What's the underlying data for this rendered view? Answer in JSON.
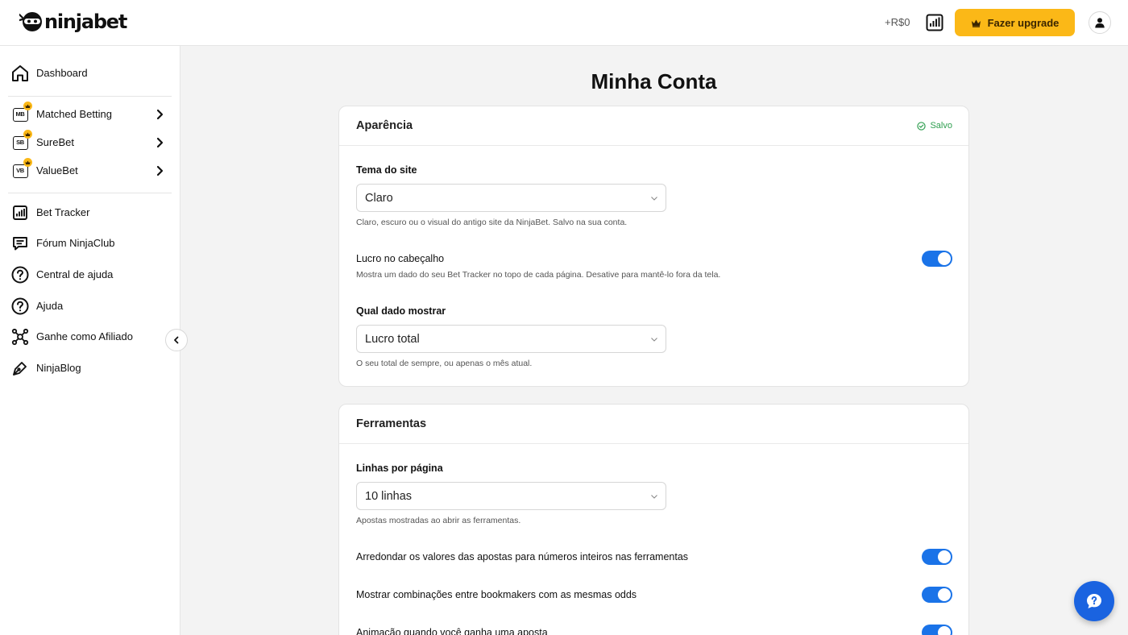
{
  "header": {
    "logo_text": "ninjabet",
    "profit": "+R$0",
    "upgrade_label": "Fazer upgrade"
  },
  "sidebar": {
    "items": [
      {
        "label": "Dashboard",
        "icon": "home-icon"
      },
      {
        "label": "Matched Betting",
        "icon": "mb-badge-icon",
        "badge": "MB"
      },
      {
        "label": "SureBet",
        "icon": "sb-badge-icon",
        "badge": "SB"
      },
      {
        "label": "ValueBet",
        "icon": "vb-badge-icon",
        "badge": "VB"
      },
      {
        "label": "Bet Tracker",
        "icon": "bar-chart-icon"
      },
      {
        "label": "Fórum NinjaClub",
        "icon": "chat-icon"
      },
      {
        "label": "Central de ajuda",
        "icon": "question-circle-icon"
      },
      {
        "label": "Ajuda",
        "icon": "question-circle-icon"
      },
      {
        "label": "Ganhe como Afiliado",
        "icon": "affiliate-icon"
      },
      {
        "label": "NinjaBlog",
        "icon": "pen-icon"
      }
    ]
  },
  "main": {
    "title": "Minha Conta",
    "appearance": {
      "title": "Aparência",
      "saved": "Salvo",
      "theme_label": "Tema do site",
      "theme_value": "Claro",
      "theme_help": "Claro, escuro ou o visual do antigo site da NinjaBet. Salvo na sua conta.",
      "header_profit_label": "Lucro no cabeçalho",
      "header_profit_help": "Mostra um dado do seu Bet Tracker no topo de cada página. Desative para mantê-lo fora da tela.",
      "header_profit_on": true,
      "data_label": "Qual dado mostrar",
      "data_value": "Lucro total",
      "data_help": "O seu total de sempre, ou apenas o mês atual."
    },
    "tools": {
      "title": "Ferramentas",
      "rows_label": "Linhas por página",
      "rows_value": "10 linhas",
      "rows_help": "Apostas mostradas ao abrir as ferramentas.",
      "round_label": "Arredondar os valores das apostas para números inteiros nas ferramentas",
      "round_on": true,
      "combos_label": "Mostrar combinações entre bookmakers com as mesmas odds",
      "combos_on": true,
      "anim_label": "Animação quando você ganha uma aposta",
      "anim_on": true
    }
  },
  "colors": {
    "accent": "#1a73e8",
    "upgrade": "#fbb817",
    "saved": "#2e9e4f"
  }
}
